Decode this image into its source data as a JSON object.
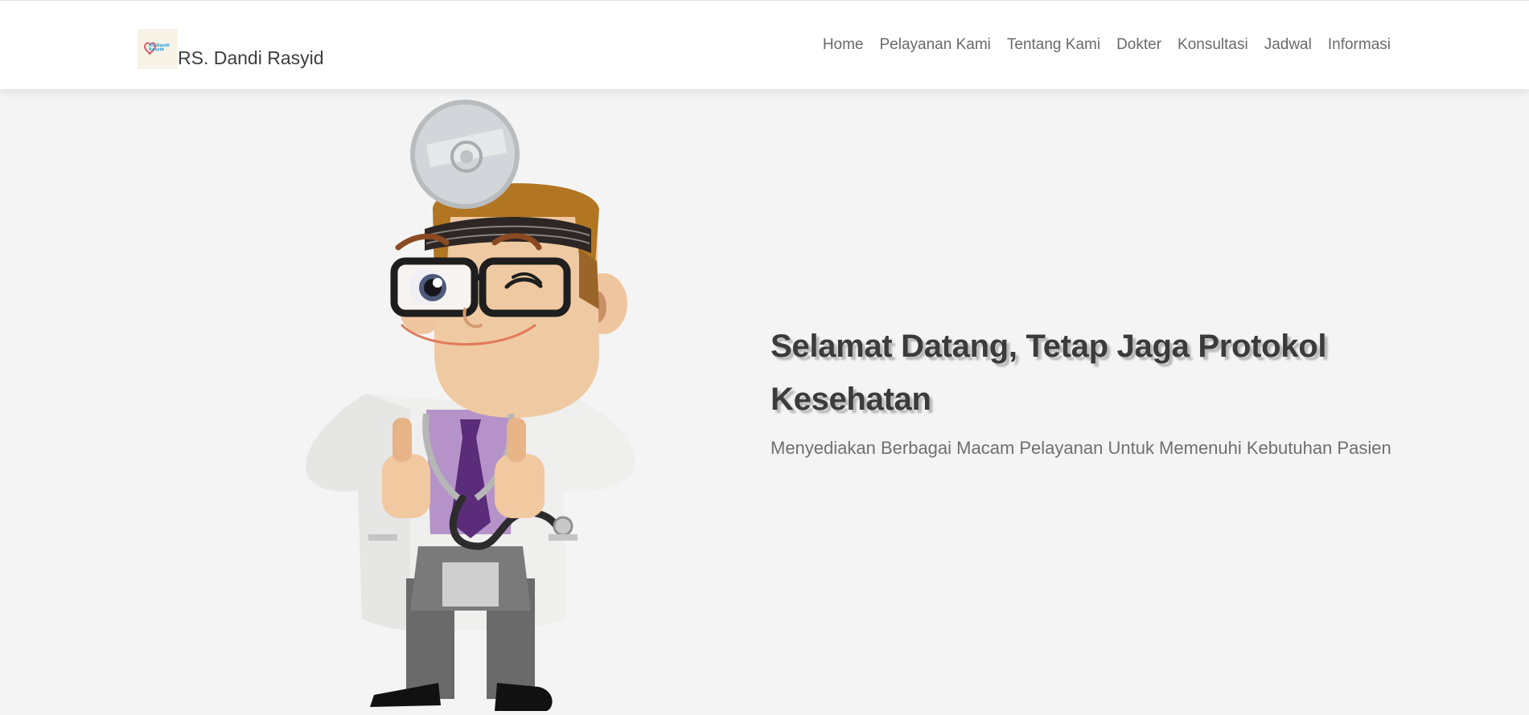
{
  "header": {
    "brand_name": "RS. Dandi Rasyid",
    "logo_text": "RS Dandi Rasyid",
    "nav": [
      {
        "label": "Home"
      },
      {
        "label": "Pelayanan Kami"
      },
      {
        "label": "Tentang Kami"
      },
      {
        "label": "Dokter"
      },
      {
        "label": "Konsultasi"
      },
      {
        "label": "Jadwal"
      },
      {
        "label": "Informasi"
      }
    ]
  },
  "hero": {
    "title": "Selamat Datang, Tetap Jaga Protokol Kesehatan",
    "subtitle": "Menyediakan Berbagai Macam Pelayanan Untuk Memenuhi Kebutuhan Pasien",
    "illustration": "cartoon-doctor-thumbs-up"
  },
  "colors": {
    "background": "#f4f4f4",
    "navbar": "#ffffff",
    "title": "#3b3b3b",
    "text": "#6f6f6f"
  }
}
